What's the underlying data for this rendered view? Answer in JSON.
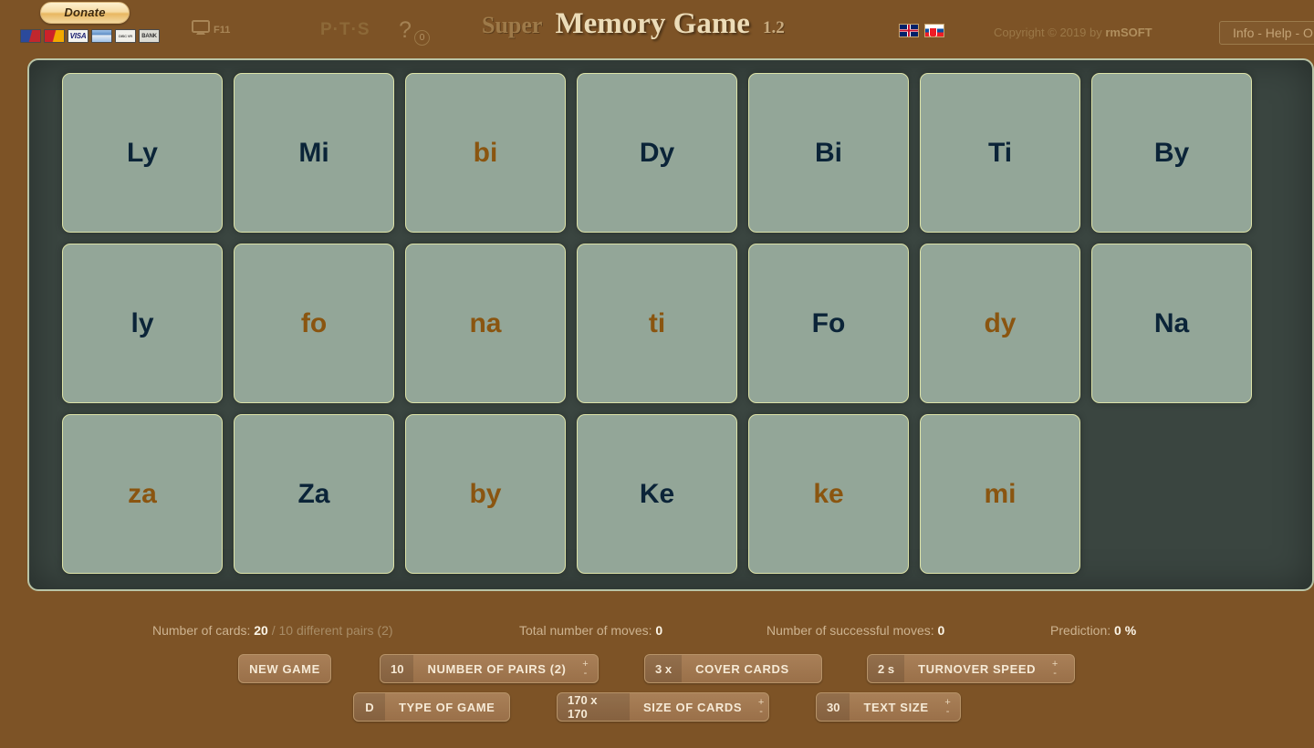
{
  "header": {
    "donate_label": "Donate",
    "payment_methods": [
      "Maestro",
      "MasterCard",
      "VISA",
      "Card",
      "DISCOVER",
      "BANK"
    ],
    "fullscreen_label": "F11",
    "pts_label": "P·T·S",
    "help_symbol": "?",
    "help_badge": "0",
    "title_prefix": "Super",
    "title_main": "Memory Game",
    "title_version": "1.2",
    "languages": [
      "English",
      "Slovak"
    ],
    "copyright_text": "Copyright © 2019 by ",
    "copyright_brand": "rmSOFT",
    "info_help_label": "Info - Help - O"
  },
  "board": {
    "cards": [
      {
        "text": "Ly",
        "style": "navy"
      },
      {
        "text": "Mi",
        "style": "navy"
      },
      {
        "text": "bi",
        "style": "brown"
      },
      {
        "text": "Dy",
        "style": "navy"
      },
      {
        "text": "Bi",
        "style": "navy"
      },
      {
        "text": "Ti",
        "style": "navy"
      },
      {
        "text": "By",
        "style": "navy"
      },
      {
        "text": "ly",
        "style": "navy"
      },
      {
        "text": "fo",
        "style": "brown"
      },
      {
        "text": "na",
        "style": "brown"
      },
      {
        "text": "ti",
        "style": "brown"
      },
      {
        "text": "Fo",
        "style": "navy"
      },
      {
        "text": "dy",
        "style": "brown"
      },
      {
        "text": "Na",
        "style": "navy"
      },
      {
        "text": "za",
        "style": "brown"
      },
      {
        "text": "Za",
        "style": "navy"
      },
      {
        "text": "by",
        "style": "brown"
      },
      {
        "text": "Ke",
        "style": "navy"
      },
      {
        "text": "ke",
        "style": "brown"
      },
      {
        "text": "mi",
        "style": "brown"
      }
    ]
  },
  "status": {
    "cards_label": "Number of cards:",
    "cards_value": "20",
    "cards_detail": "/ 10 different pairs (2)",
    "moves_label": "Total number of moves:",
    "moves_value": "0",
    "success_label": "Number of successful moves:",
    "success_value": "0",
    "prediction_label": "Prediction:",
    "prediction_value": "0 %"
  },
  "controls": {
    "new_game_label": "NEW GAME",
    "pairs_value": "10",
    "pairs_label": "NUMBER OF PAIRS (2)",
    "cover_value": "3 x",
    "cover_label": "COVER CARDS",
    "speed_value": "2 s",
    "speed_label": "TURNOVER SPEED",
    "type_value": "D",
    "type_label": "TYPE OF GAME",
    "size_value": "170 x 170",
    "size_label": "SIZE OF CARDS",
    "textsize_value": "30",
    "textsize_label": "TEXT SIZE",
    "spin_up": "+",
    "spin_down": "-"
  },
  "colors": {
    "page_bg": "#7d5326",
    "board_bg": "#3a4540",
    "card_bg": "#93a698",
    "card_border": "#dde3a8",
    "card_text_navy": "#0b2438",
    "card_text_brown": "#8a5510",
    "control_bg": "#a98058"
  }
}
